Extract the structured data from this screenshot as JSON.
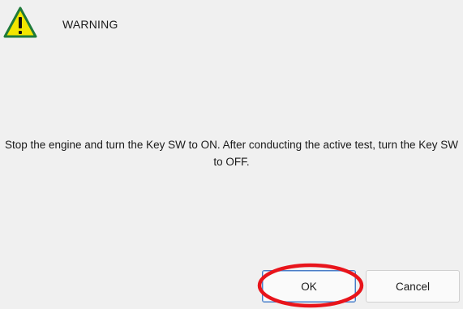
{
  "dialog": {
    "title": "WARNING",
    "icon": "warning-triangle-icon",
    "message": "Stop the engine and turn the Key SW to ON. After conducting the active test, turn the Key SW to OFF.",
    "buttons": {
      "ok_label": "OK",
      "cancel_label": "Cancel"
    }
  },
  "annotation": {
    "highlight": "ok-button",
    "color": "#e8141b"
  },
  "colors": {
    "background": "#f0f0f0",
    "icon_fill": "#f2e600",
    "icon_border": "#1f7a3a",
    "ok_border": "#4a7cc4"
  }
}
